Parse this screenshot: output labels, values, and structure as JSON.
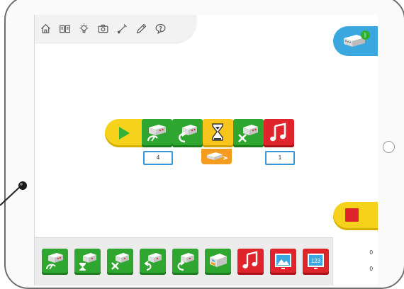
{
  "toolbar": {
    "icons": [
      "home-icon",
      "book-icon",
      "lightbulb-icon",
      "camera-icon",
      "dropper-icon",
      "pencil-icon",
      "help-icon"
    ]
  },
  "hub": {
    "icon": "hub-brick-icon",
    "status": "bluetooth-connected"
  },
  "program": {
    "blocks": [
      {
        "name": "start-block",
        "color": "#f7d21c"
      },
      {
        "name": "motor-power-block",
        "param": "4",
        "color": "#2fa62f"
      },
      {
        "name": "motor-direction-block",
        "color": "#2fa62f"
      },
      {
        "name": "wait-for-block",
        "input": "motion-sensor",
        "color": "#f7c51c"
      },
      {
        "name": "motor-off-block",
        "color": "#2fa62f"
      },
      {
        "name": "play-sound-block",
        "param": "1",
        "color": "#e0242c"
      }
    ]
  },
  "palette": {
    "items": [
      "motor-power",
      "motor-on-for",
      "motor-off",
      "motor-this-way",
      "motor-that-way",
      "light",
      "play-sound",
      "display-background",
      "display-number"
    ]
  },
  "counters": {
    "top": "0",
    "bottom": "0"
  },
  "colors": {
    "accent_blue": "#3aa7de",
    "block_green": "#2fa62f",
    "block_red": "#e0242c",
    "block_yellow": "#f7d21c"
  }
}
